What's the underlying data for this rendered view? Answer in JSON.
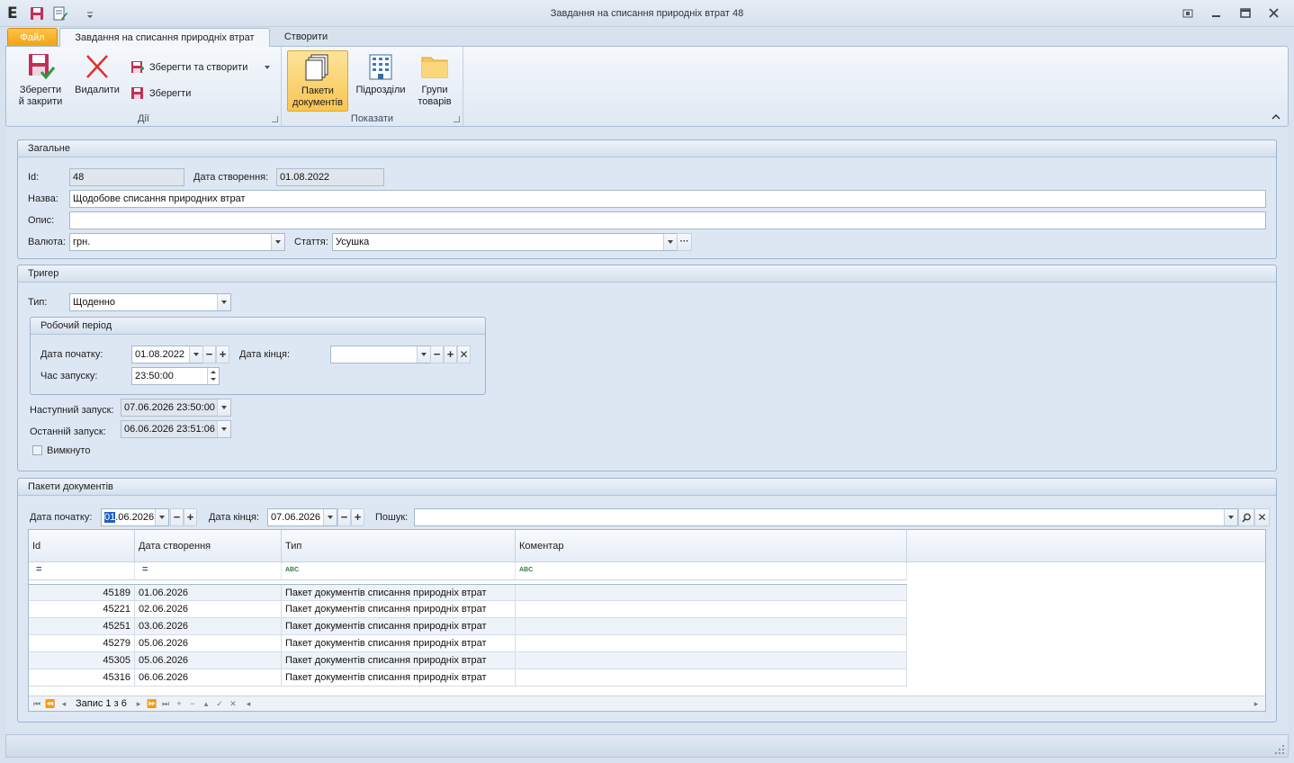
{
  "window": {
    "title": "Завдання на списання природніх втрат 48",
    "logo": "E"
  },
  "tabs": {
    "file": "Файл",
    "active": "Завдання на списання природніх втрат",
    "create": "Створити"
  },
  "ribbon": {
    "actions_group": "Дії",
    "show_group": "Показати",
    "save_close_l1": "Зберегти",
    "save_close_l2": "й закрити",
    "delete": "Видалити",
    "save_and_create": "Зберегти та створити",
    "save": "Зберегти",
    "packets_l1": "Пакети",
    "packets_l2": "документів",
    "departments": "Підрозділи",
    "groups_l1": "Групи",
    "groups_l2": "товарів"
  },
  "general": {
    "header": "Загальне",
    "id_label": "Id:",
    "id_value": "48",
    "created_label": "Дата створення:",
    "created_value": "01.08.2022",
    "name_label": "Назва:",
    "name_value": "Щодобове списання природних втрат",
    "desc_label": "Опис:",
    "desc_value": "",
    "currency_label": "Валюта:",
    "currency_value": "грн.",
    "article_label": "Стаття:",
    "article_value": "Усушка",
    "ellipsis": "···"
  },
  "trigger": {
    "header": "Тригер",
    "type_label": "Тип:",
    "type_value": "Щоденно",
    "period_header": "Робочий період",
    "start_label": "Дата початку:",
    "start_value": "01.08.2022",
    "end_label": "Дата кінця:",
    "end_value": "",
    "time_label": "Час запуску:",
    "time_value": "23:50:00",
    "next_label": "Наступний запуск:",
    "next_value": "07.06.2026 23:50:00",
    "last_label": "Останній запуск:",
    "last_value": "06.06.2026 23:51:06",
    "disabled_label": "Вимкнуто",
    "disabled_checked": false
  },
  "packets": {
    "header": "Пакети документів",
    "start_label": "Дата початку:",
    "start_value_sel": "01",
    "start_value_rest": ".06.2026",
    "end_label": "Дата кінця:",
    "end_value": "07.06.2026",
    "search_label": "Пошук:",
    "search_value": "",
    "columns": [
      "Id",
      "Дата створення",
      "Тип",
      "Коментар"
    ],
    "filter_eq": "=",
    "filter_abc": "ABC",
    "rows": [
      {
        "id": "45189",
        "date": "01.06.2026",
        "type": "Пакет документів списання природніх втрат",
        "comment": ""
      },
      {
        "id": "45221",
        "date": "02.06.2026",
        "type": "Пакет документів списання природніх втрат",
        "comment": ""
      },
      {
        "id": "45251",
        "date": "03.06.2026",
        "type": "Пакет документів списання природніх втрат",
        "comment": ""
      },
      {
        "id": "45279",
        "date": "05.06.2026",
        "type": "Пакет документів списання природніх втрат",
        "comment": ""
      },
      {
        "id": "45305",
        "date": "05.06.2026",
        "type": "Пакет документів списання природніх втрат",
        "comment": ""
      },
      {
        "id": "45316",
        "date": "06.06.2026",
        "type": "Пакет документів списання природніх втрат",
        "comment": ""
      }
    ],
    "record_text": "Запис 1 з 6"
  }
}
